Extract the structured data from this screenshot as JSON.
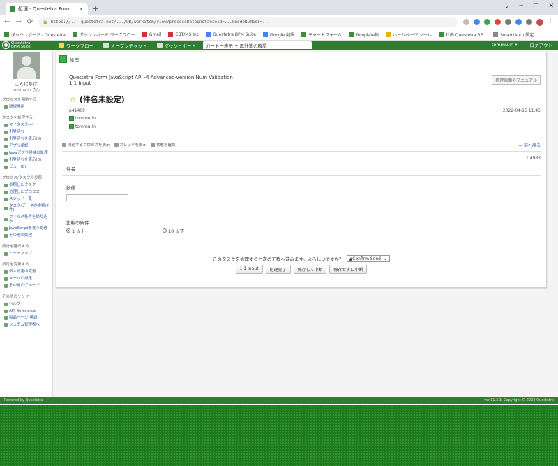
{
  "browser": {
    "tab_title": "処理 - Questetra Form JavaScript A",
    "new_tab_symbol": "+",
    "url": "https://... questetra.net/.../OR/workitem/view?processDataInstanceId=...&nodeNumber=...",
    "bookmarks": [
      "ダッシュボード - Questetra",
      "ダッシュボード ワークフロー",
      "Gmail",
      "CBT/MS Inc",
      "Questetra BPM Suite",
      "Google 翻訳",
      "チャートフォーム",
      "Template集",
      "ホームページ ツール",
      "社内 Questetra BP...",
      "Smart/Auth 設定"
    ]
  },
  "appnav": {
    "logo_line1": "Questetra",
    "logo_line2": "BPM Suite",
    "items": [
      "ワークフロー",
      "オープンチャット",
      "ダッシュボード"
    ],
    "active_tab": "カートー表示 + 再計算の確認",
    "user": "tommu.in ▾",
    "logout": "ログアウト"
  },
  "sidebar": {
    "user_name": "こんにちは",
    "user_sub": "tommu.in さん",
    "sections": [
      {
        "head": "プロセスを開始する",
        "items": [
          "新規開始"
        ]
      },
      {
        "head": "タスクを処理する",
        "items": [
          "マイタスク(4)",
          "引受待ち",
          "引受待ちを表示(0)",
          "アプリ承認",
          "Javaアプリ候補の処理",
          "引受待ちを表示(0)",
          "ビュー(0)"
        ]
      },
      {
        "head": "プロセス/タスクの参照",
        "items": [
          "参照したタスク",
          "処理したプロセス",
          "スレッド一覧",
          "タスク/データの検索(7件)",
          "フィルタ条件を絞り込み",
          "JavaScriptを使う処理",
          "その他の処理"
        ]
      },
      {
        "head": "統計を確認する",
        "items": [
          "ヒートマップ"
        ]
      },
      {
        "head": "設定を変更する",
        "items": [
          "個人設定の変更",
          "メールの設定",
          "その他のグループ"
        ]
      },
      {
        "head": "その他のリンク",
        "items": [
          "ヘルプ",
          "API Reference",
          "製品ページ(英語)",
          "システム管理者へ"
        ]
      }
    ]
  },
  "content": {
    "step_label": "処理",
    "wf_name": "Questetra Form JavaScript API -4 Advanced-version Num Validation",
    "wf_step": "1.1 Input",
    "manual_btn": "処理画面のマニュアル",
    "title": "(件名未設定)",
    "process_id": "p41409",
    "timestamp": "2022-04-15 11:45",
    "users": [
      "tommu.in",
      "tommu.in"
    ],
    "toolbar": [
      "関連するプロセスを表示",
      "スレッドを表示",
      "状態を確認"
    ],
    "prev_link": "← 前へ戻る",
    "total_number": "1.4983",
    "field_name_label": "件名",
    "field_value_label": "数値",
    "field_compare_label": "比較の条件",
    "radio_options": [
      "1 以上",
      "10 以下"
    ],
    "confirm_text": "このタスクを処理すると次の工程へ進みます。よろしいですか？",
    "confirm_select": "▲Confirm Send",
    "buttons": [
      "1.1 Input",
      "処理完了",
      "保存して中断",
      "保存せずに中断"
    ]
  },
  "footer": {
    "left": "Powered by Questetra",
    "right": "ver.11.3.3, Copyright © 2022 Questetra"
  }
}
